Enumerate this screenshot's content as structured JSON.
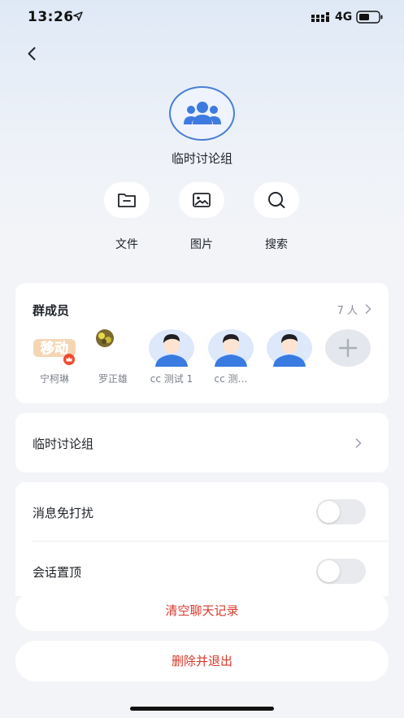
{
  "status_bar": {
    "time": "13:26",
    "network": "4G"
  },
  "group": {
    "name": "临时讨论组"
  },
  "actions": [
    {
      "label": "文件",
      "icon": "folder-icon"
    },
    {
      "label": "图片",
      "icon": "image-icon"
    },
    {
      "label": "搜索",
      "icon": "search-icon"
    }
  ],
  "members": {
    "title": "群成员",
    "count": "7 人",
    "list": [
      {
        "name": "宁柯琳",
        "avatar": "photo",
        "badge": "crown"
      },
      {
        "name": "罗正雄",
        "avatar": "photo"
      },
      {
        "name": "cc 测试 1",
        "avatar": "default"
      },
      {
        "name": "cc 测…",
        "avatar": "default"
      },
      {
        "name": "",
        "avatar": "default"
      }
    ]
  },
  "group_row": {
    "label": "临时讨论组"
  },
  "settings": [
    {
      "label": "消息免打扰",
      "on": false
    },
    {
      "label": "会话置顶",
      "on": false
    }
  ],
  "buttons": {
    "clear_history": "清空聊天记录",
    "delete_exit": "删除并退出"
  },
  "colors": {
    "accent": "#4a7fd6",
    "danger": "#d9392c",
    "default_avatar_bg": "#dde8fb"
  }
}
